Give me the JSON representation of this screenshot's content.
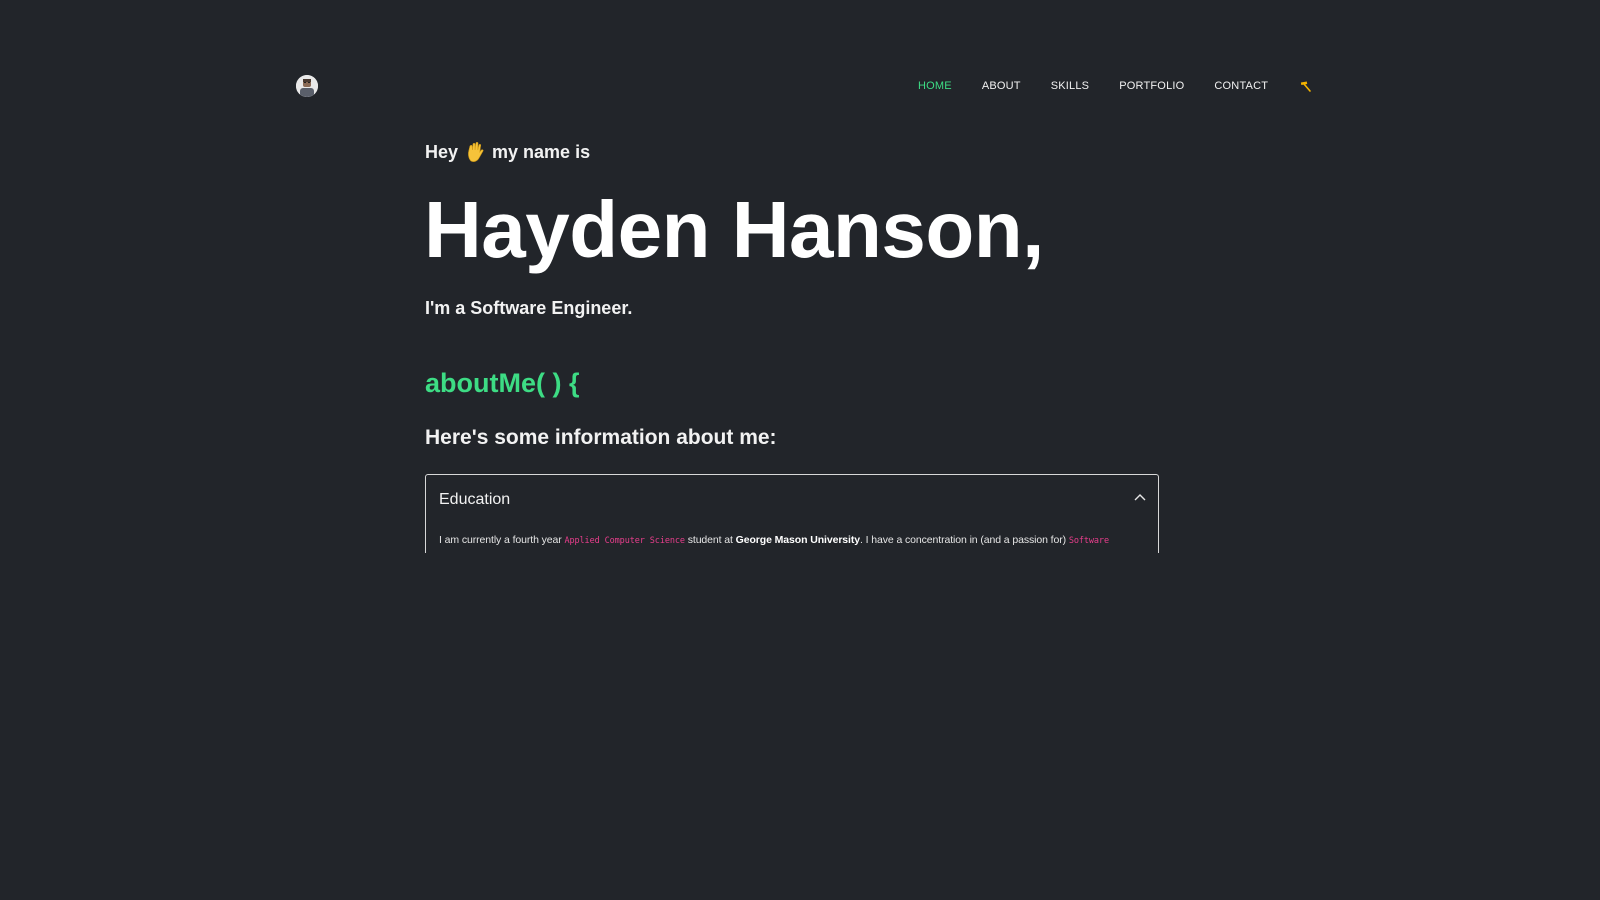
{
  "header": {
    "avatar_alt": "profile photo",
    "nav": [
      {
        "label": "HOME",
        "active": true
      },
      {
        "label": "ABOUT",
        "active": false
      },
      {
        "label": "SKILLS",
        "active": false
      },
      {
        "label": "PORTFOLIO",
        "active": false
      },
      {
        "label": "CONTACT",
        "active": false
      }
    ],
    "theme_toggle_icon": "hammer-icon"
  },
  "hero": {
    "greeting_before": "Hey",
    "greeting_emoji": "waving-hand-icon",
    "greeting_after": "my name is",
    "name": "Hayden Hanson,",
    "role": "I'm a Software Engineer."
  },
  "about": {
    "title": "aboutMe( ) {",
    "subtitle": "Here's some information about me:",
    "accordion": {
      "title": "Education",
      "expanded": true,
      "body": {
        "text_1": "I am currently a fourth year ",
        "code_1": "Applied Computer Science",
        "text_2": " student at ",
        "bold_1": "George Mason University",
        "text_3": ". I have a concentration in (and a passion for) ",
        "code_2": "Software"
      }
    }
  },
  "colors": {
    "background": "#22252a",
    "accent": "#3ddc84",
    "code": "#e83e8c",
    "toggle": "#f5b400"
  }
}
